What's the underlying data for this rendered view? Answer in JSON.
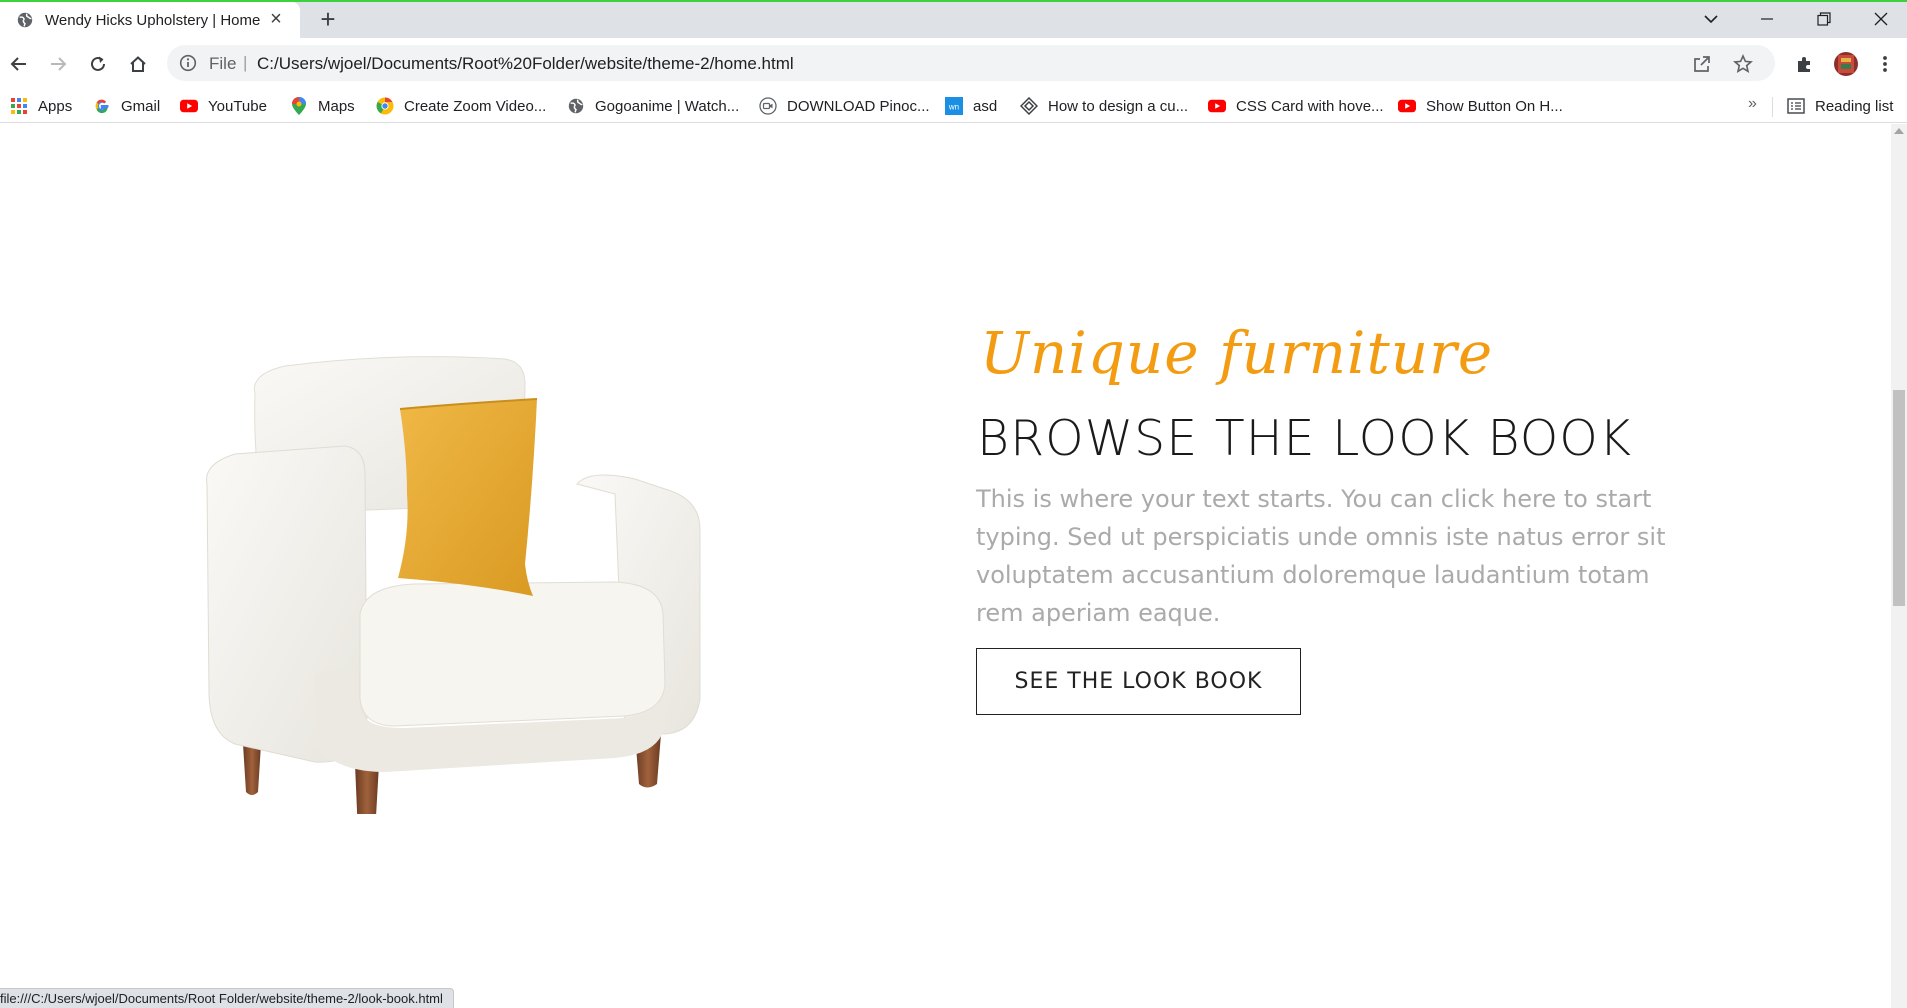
{
  "browser": {
    "tab_title": "Wendy Hicks Upholstery | Home",
    "url_scheme": "File",
    "url": "C:/Users/wjoel/Documents/Root%20Folder/website/theme-2/home.html"
  },
  "bookmarks": [
    {
      "label": "Apps",
      "icon": "apps-grid-icon"
    },
    {
      "label": "Gmail",
      "icon": "google-icon"
    },
    {
      "label": "YouTube",
      "icon": "youtube-icon"
    },
    {
      "label": "Maps",
      "icon": "maps-icon"
    },
    {
      "label": "Create Zoom Video...",
      "icon": "chrome-icon"
    },
    {
      "label": "Gogoanime | Watch...",
      "icon": "globe-icon"
    },
    {
      "label": "DOWNLOAD Pinoc...",
      "icon": "video-icon"
    },
    {
      "label": "asd",
      "icon": "wn-icon"
    },
    {
      "label": "How to design a cu...",
      "icon": "diamond-icon"
    },
    {
      "label": "CSS Card with hove...",
      "icon": "youtube-icon"
    },
    {
      "label": "Show Button On H...",
      "icon": "youtube-icon"
    }
  ],
  "reading_list": "Reading list",
  "hero": {
    "kicker": "Unique furniture",
    "headline": "BROWSE THE LOOK BOOK",
    "body": "This is where your text starts. You can click here to start typing. Sed ut perspiciatis unde omnis iste natus error sit voluptatem accusantium doloremque laudantium totam rem aperiam eaque.",
    "cta": "SEE THE LOOK BOOK"
  },
  "status_url": "file:///C:/Users/wjoel/Documents/Root Folder/website/theme-2/look-book.html",
  "colors": {
    "accent": "#f39c12",
    "pillow": "#e8ad35",
    "chair": "#f3f0ea"
  }
}
